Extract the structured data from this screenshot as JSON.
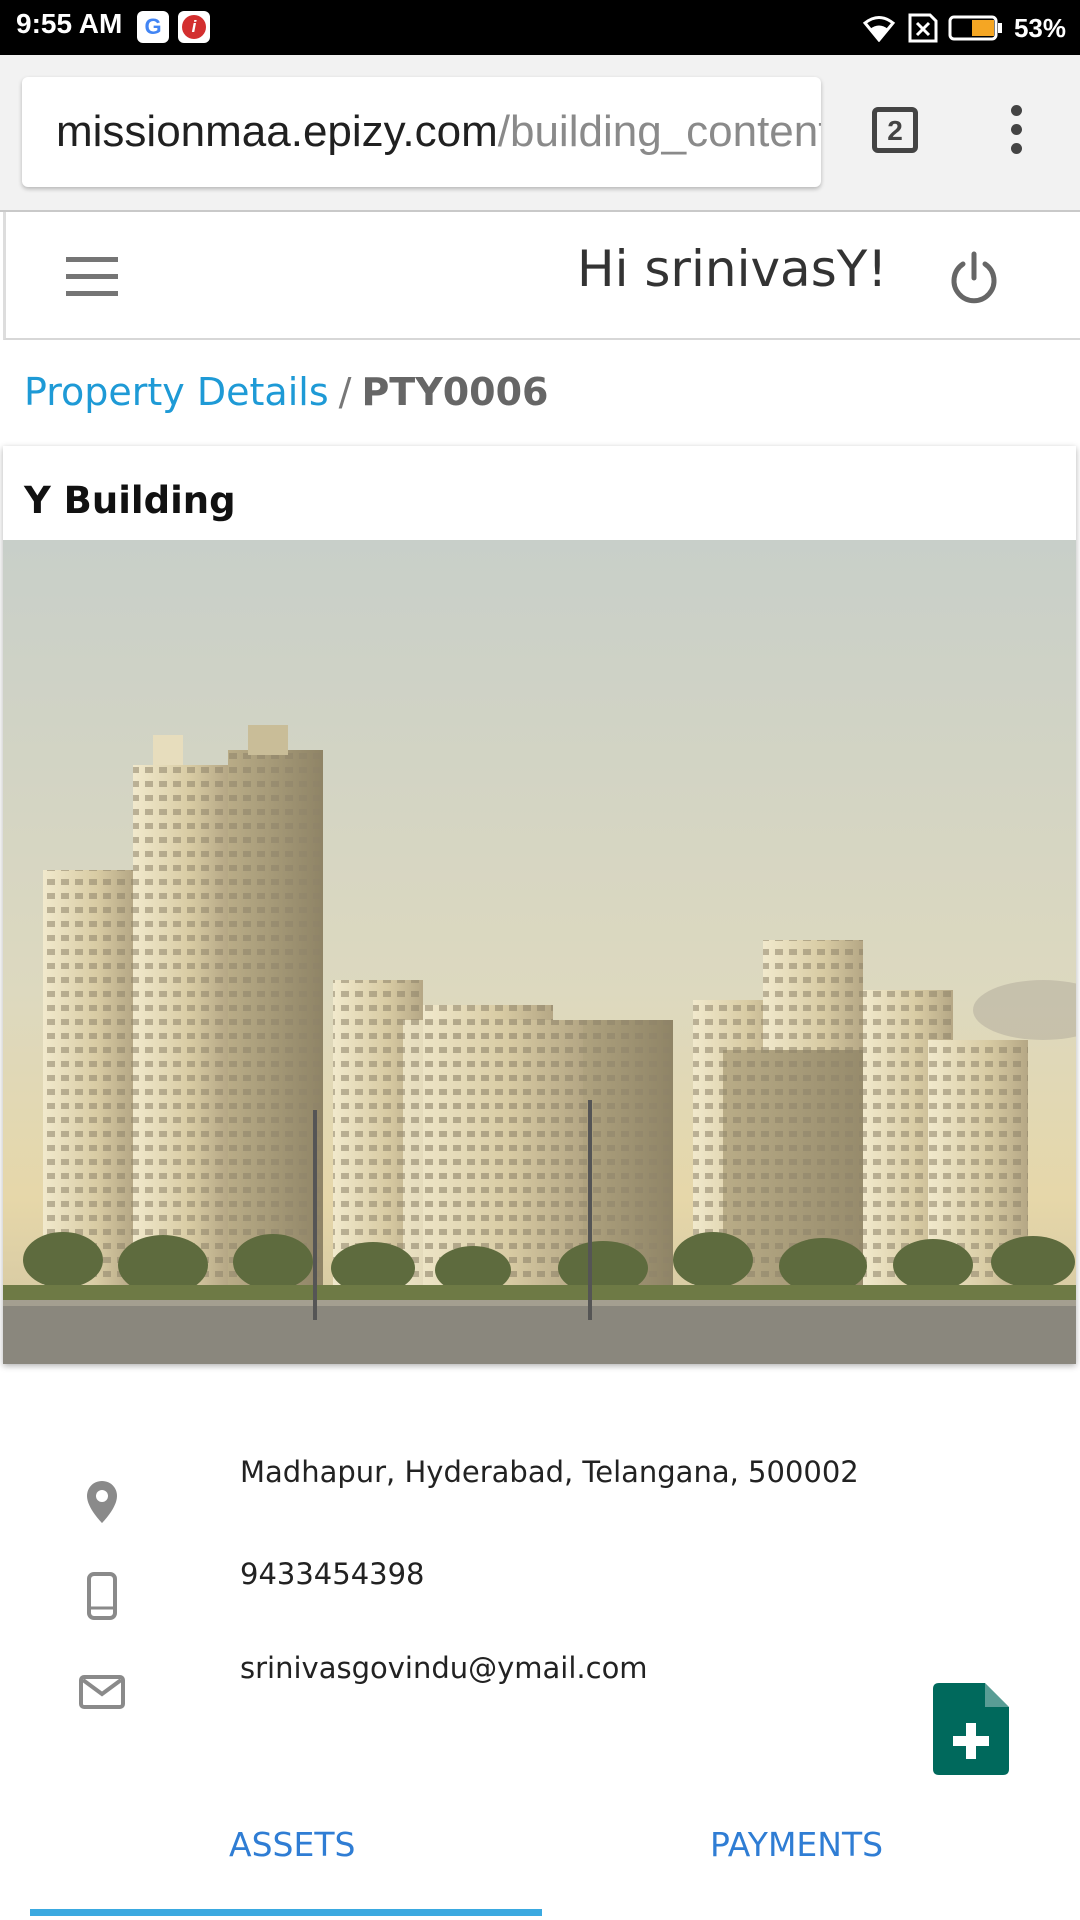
{
  "status_bar": {
    "time": "9:55 AM",
    "battery": "53%",
    "google_app_letter": "G",
    "irctc_app_letter": "i"
  },
  "browser": {
    "url_host": "missionmaa.epizy.com",
    "url_path": "/building_content",
    "tab_count": "2"
  },
  "header": {
    "greeting": "Hi srinivasY!"
  },
  "breadcrumb": {
    "link": "Property Details",
    "separator": "/",
    "current": "PTY0006"
  },
  "property": {
    "name": "Y Building",
    "address": "Madhapur, Hyderabad, Telangana, 500002",
    "phone": "9433454398",
    "email": "srinivasgovindu@ymail.com"
  },
  "tabs": [
    {
      "label": "ASSETS",
      "active": true
    },
    {
      "label": "PAYMENTS",
      "active": false
    }
  ],
  "colors": {
    "accent": "#1e9ad6",
    "tab_text": "#2f7dd4",
    "fab": "#00695c"
  }
}
